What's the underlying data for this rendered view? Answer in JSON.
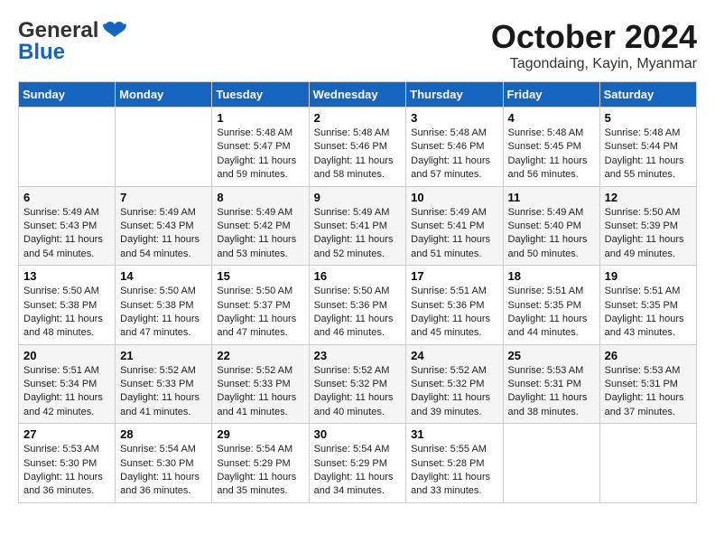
{
  "logo": {
    "general": "General",
    "blue": "Blue"
  },
  "title": "October 2024",
  "subtitle": "Tagondaing, Kayin, Myanmar",
  "days_header": [
    "Sunday",
    "Monday",
    "Tuesday",
    "Wednesday",
    "Thursday",
    "Friday",
    "Saturday"
  ],
  "weeks": [
    [
      {
        "day": "",
        "info": ""
      },
      {
        "day": "",
        "info": ""
      },
      {
        "day": "1",
        "info": "Sunrise: 5:48 AM\nSunset: 5:47 PM\nDaylight: 11 hours and 59 minutes."
      },
      {
        "day": "2",
        "info": "Sunrise: 5:48 AM\nSunset: 5:46 PM\nDaylight: 11 hours and 58 minutes."
      },
      {
        "day": "3",
        "info": "Sunrise: 5:48 AM\nSunset: 5:46 PM\nDaylight: 11 hours and 57 minutes."
      },
      {
        "day": "4",
        "info": "Sunrise: 5:48 AM\nSunset: 5:45 PM\nDaylight: 11 hours and 56 minutes."
      },
      {
        "day": "5",
        "info": "Sunrise: 5:48 AM\nSunset: 5:44 PM\nDaylight: 11 hours and 55 minutes."
      }
    ],
    [
      {
        "day": "6",
        "info": "Sunrise: 5:49 AM\nSunset: 5:43 PM\nDaylight: 11 hours and 54 minutes."
      },
      {
        "day": "7",
        "info": "Sunrise: 5:49 AM\nSunset: 5:43 PM\nDaylight: 11 hours and 54 minutes."
      },
      {
        "day": "8",
        "info": "Sunrise: 5:49 AM\nSunset: 5:42 PM\nDaylight: 11 hours and 53 minutes."
      },
      {
        "day": "9",
        "info": "Sunrise: 5:49 AM\nSunset: 5:41 PM\nDaylight: 11 hours and 52 minutes."
      },
      {
        "day": "10",
        "info": "Sunrise: 5:49 AM\nSunset: 5:41 PM\nDaylight: 11 hours and 51 minutes."
      },
      {
        "day": "11",
        "info": "Sunrise: 5:49 AM\nSunset: 5:40 PM\nDaylight: 11 hours and 50 minutes."
      },
      {
        "day": "12",
        "info": "Sunrise: 5:50 AM\nSunset: 5:39 PM\nDaylight: 11 hours and 49 minutes."
      }
    ],
    [
      {
        "day": "13",
        "info": "Sunrise: 5:50 AM\nSunset: 5:38 PM\nDaylight: 11 hours and 48 minutes."
      },
      {
        "day": "14",
        "info": "Sunrise: 5:50 AM\nSunset: 5:38 PM\nDaylight: 11 hours and 47 minutes."
      },
      {
        "day": "15",
        "info": "Sunrise: 5:50 AM\nSunset: 5:37 PM\nDaylight: 11 hours and 47 minutes."
      },
      {
        "day": "16",
        "info": "Sunrise: 5:50 AM\nSunset: 5:36 PM\nDaylight: 11 hours and 46 minutes."
      },
      {
        "day": "17",
        "info": "Sunrise: 5:51 AM\nSunset: 5:36 PM\nDaylight: 11 hours and 45 minutes."
      },
      {
        "day": "18",
        "info": "Sunrise: 5:51 AM\nSunset: 5:35 PM\nDaylight: 11 hours and 44 minutes."
      },
      {
        "day": "19",
        "info": "Sunrise: 5:51 AM\nSunset: 5:35 PM\nDaylight: 11 hours and 43 minutes."
      }
    ],
    [
      {
        "day": "20",
        "info": "Sunrise: 5:51 AM\nSunset: 5:34 PM\nDaylight: 11 hours and 42 minutes."
      },
      {
        "day": "21",
        "info": "Sunrise: 5:52 AM\nSunset: 5:33 PM\nDaylight: 11 hours and 41 minutes."
      },
      {
        "day": "22",
        "info": "Sunrise: 5:52 AM\nSunset: 5:33 PM\nDaylight: 11 hours and 41 minutes."
      },
      {
        "day": "23",
        "info": "Sunrise: 5:52 AM\nSunset: 5:32 PM\nDaylight: 11 hours and 40 minutes."
      },
      {
        "day": "24",
        "info": "Sunrise: 5:52 AM\nSunset: 5:32 PM\nDaylight: 11 hours and 39 minutes."
      },
      {
        "day": "25",
        "info": "Sunrise: 5:53 AM\nSunset: 5:31 PM\nDaylight: 11 hours and 38 minutes."
      },
      {
        "day": "26",
        "info": "Sunrise: 5:53 AM\nSunset: 5:31 PM\nDaylight: 11 hours and 37 minutes."
      }
    ],
    [
      {
        "day": "27",
        "info": "Sunrise: 5:53 AM\nSunset: 5:30 PM\nDaylight: 11 hours and 36 minutes."
      },
      {
        "day": "28",
        "info": "Sunrise: 5:54 AM\nSunset: 5:30 PM\nDaylight: 11 hours and 36 minutes."
      },
      {
        "day": "29",
        "info": "Sunrise: 5:54 AM\nSunset: 5:29 PM\nDaylight: 11 hours and 35 minutes."
      },
      {
        "day": "30",
        "info": "Sunrise: 5:54 AM\nSunset: 5:29 PM\nDaylight: 11 hours and 34 minutes."
      },
      {
        "day": "31",
        "info": "Sunrise: 5:55 AM\nSunset: 5:28 PM\nDaylight: 11 hours and 33 minutes."
      },
      {
        "day": "",
        "info": ""
      },
      {
        "day": "",
        "info": ""
      }
    ]
  ]
}
